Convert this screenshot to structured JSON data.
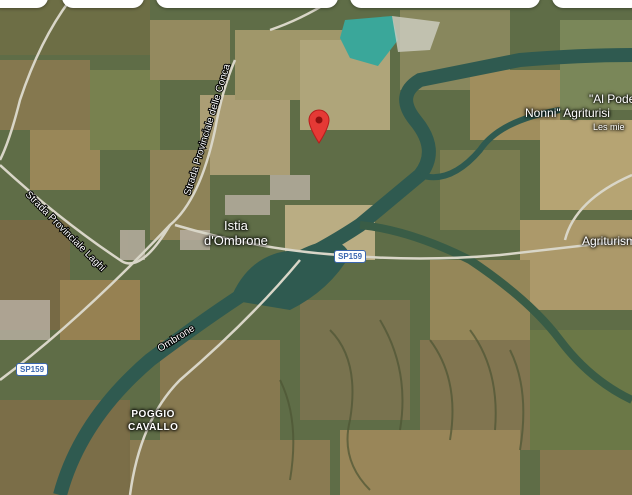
{
  "map": {
    "places": {
      "istia_line1": "Istia",
      "istia_line2": "d'Ombrone",
      "poggio_line1": "POGGIO",
      "poggio_line2": "CAVALLO",
      "al_podere_line1": "\"Al Pode",
      "al_podere_line2": "Nonni\" Agriturisi",
      "les_mie": "Les mie",
      "agriturism": "Agriturism"
    },
    "roads": {
      "conca": "Strada Provinciale delle Conca",
      "laghi": "Strada Provinciale Laghi",
      "river": "Ombrone"
    },
    "shields": {
      "sp159_center": "SP159",
      "sp159_left": "SP159"
    },
    "marker": {
      "icon": "location-pin-icon",
      "color": "#e53935"
    },
    "colors": {
      "river": "#2f5a50",
      "road": "#d9d6c8",
      "shield_border": "#3b67b0"
    }
  }
}
